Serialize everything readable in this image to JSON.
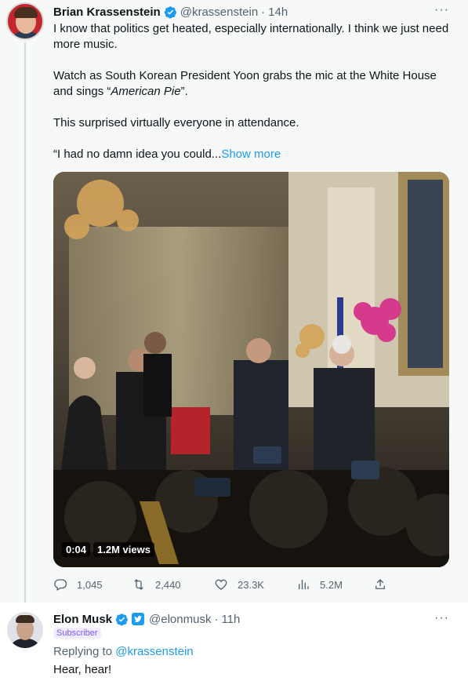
{
  "tweet": {
    "author_name": "Brian Krassenstein",
    "handle": "@krassenstein",
    "dot": "·",
    "time": "14h",
    "more_icon": "···",
    "text_lines": [
      "I know that politics get heated, especially internationally.  I think we just need more music.",
      "Watch as South Korean President Yoon grabs the mic at the White House and sings “",
      "American Pie",
      "”.",
      "This surprised virtually everyone in attendance.",
      "“I had no damn idea you could..."
    ],
    "show_more": "Show more",
    "video": {
      "duration": "0:04",
      "views": "1.2M views"
    },
    "actions": {
      "replies": "1,045",
      "retweets": "2,440",
      "likes": "23.3K",
      "views": "5.2M"
    }
  },
  "reply": {
    "author_name": "Elon Musk",
    "handle": "@elonmusk",
    "dot": "·",
    "time": "11h",
    "more_icon": "···",
    "badge": "Subscriber",
    "replying_prefix": "Replying to ",
    "replying_handle": "@krassenstein",
    "text": "Hear, hear!"
  },
  "colors": {
    "accent": "#1d9bf0",
    "secondary_text": "#536471",
    "subscriber": "#7856ff"
  },
  "icons": [
    "verified-badge-icon",
    "more-icon",
    "reply-icon",
    "retweet-icon",
    "like-icon",
    "views-icon",
    "share-icon",
    "organization-badge-icon"
  ]
}
